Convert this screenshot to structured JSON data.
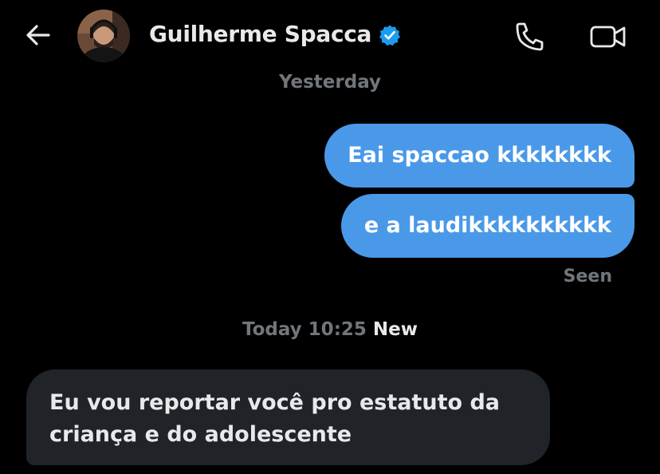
{
  "header": {
    "contact_name": "Guilherme Spacca",
    "verified_color": "#1d9bf0",
    "icons": [
      "back-arrow-icon",
      "avatar",
      "verified-badge-icon",
      "phone-icon",
      "video-camera-icon"
    ]
  },
  "conversation": {
    "separator_yesterday": "Yesterday",
    "messages_out": [
      {
        "text": "Eai spaccao kkkkkkkk"
      },
      {
        "text": "e a laudikkkkkkkkkk"
      }
    ],
    "seen_label": "Seen",
    "separator_today": {
      "time": "Today 10:25",
      "badge": "New"
    },
    "messages_in": [
      {
        "text": "Eu vou reportar você pro estatuto da criança e do adolescente"
      }
    ]
  },
  "colors": {
    "background": "#000000",
    "outgoing_bubble": "#4a99e9",
    "incoming_bubble": "#202327",
    "secondary_text": "#71767b",
    "primary_text": "#e7e9ea"
  }
}
